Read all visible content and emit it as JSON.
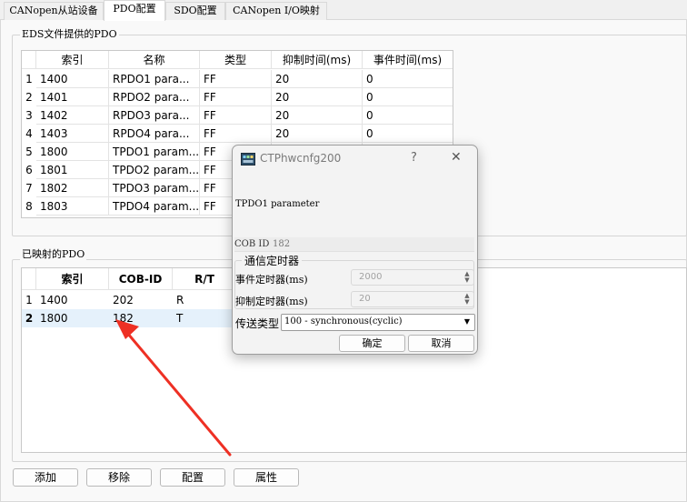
{
  "tabs": [
    {
      "label": "CANopen从站设备"
    },
    {
      "label": "PDO配置"
    },
    {
      "label": "SDO配置"
    },
    {
      "label": "CANopen I/O映射"
    }
  ],
  "eds_group": {
    "title": "EDS文件提供的PDO",
    "columns": [
      "索引",
      "名称",
      "类型",
      "抑制时间(ms)",
      "事件时间(ms)"
    ],
    "rows": [
      {
        "num": "1",
        "index": "1400",
        "name": "RPDO1 para...",
        "type": "FF",
        "inhibit": "20",
        "event": "0"
      },
      {
        "num": "2",
        "index": "1401",
        "name": "RPDO2 para...",
        "type": "FF",
        "inhibit": "20",
        "event": "0"
      },
      {
        "num": "3",
        "index": "1402",
        "name": "RPDO3 para...",
        "type": "FF",
        "inhibit": "20",
        "event": "0"
      },
      {
        "num": "4",
        "index": "1403",
        "name": "RPDO4 para...",
        "type": "FF",
        "inhibit": "20",
        "event": "0"
      },
      {
        "num": "5",
        "index": "1800",
        "name": "TPDO1 param...",
        "type": "FF",
        "inhibit": "",
        "event": ""
      },
      {
        "num": "6",
        "index": "1801",
        "name": "TPDO2 param...",
        "type": "FF",
        "inhibit": "",
        "event": ""
      },
      {
        "num": "7",
        "index": "1802",
        "name": "TPDO3 param...",
        "type": "FF",
        "inhibit": "",
        "event": ""
      },
      {
        "num": "8",
        "index": "1803",
        "name": "TPDO4 param...",
        "type": "FF",
        "inhibit": "",
        "event": ""
      }
    ]
  },
  "mapped_group": {
    "title": "已映射的PDO",
    "columns": [
      "索引",
      "COB-ID",
      "R/T"
    ],
    "rows": [
      {
        "num": "1",
        "index": "1400",
        "cob": "202",
        "rt": "R"
      },
      {
        "num": "2",
        "index": "1800",
        "cob": "182",
        "rt": "T"
      }
    ]
  },
  "buttons": {
    "add": "添加",
    "remove": "移除",
    "config": "配置",
    "properties": "属性"
  },
  "dialog": {
    "title": "CTPhwcnfg200",
    "help": "?",
    "close": "✕",
    "param_name": "TPDO1 parameter",
    "cob_label": "COB ID",
    "cob_value": "182",
    "timer_group_title": "通信定时器",
    "event_timer_label": "事件定时器(ms)",
    "event_timer_value": "2000",
    "inhibit_timer_label": "抑制定时器(ms)",
    "inhibit_timer_value": "20",
    "transfer_label": "传送类型",
    "transfer_value": "100 - synchronous(cyclic)",
    "ok": "确定",
    "cancel": "取消"
  },
  "colors": {
    "annotation_arrow": "#ee3024",
    "selected_row": "#e5f1fb"
  }
}
